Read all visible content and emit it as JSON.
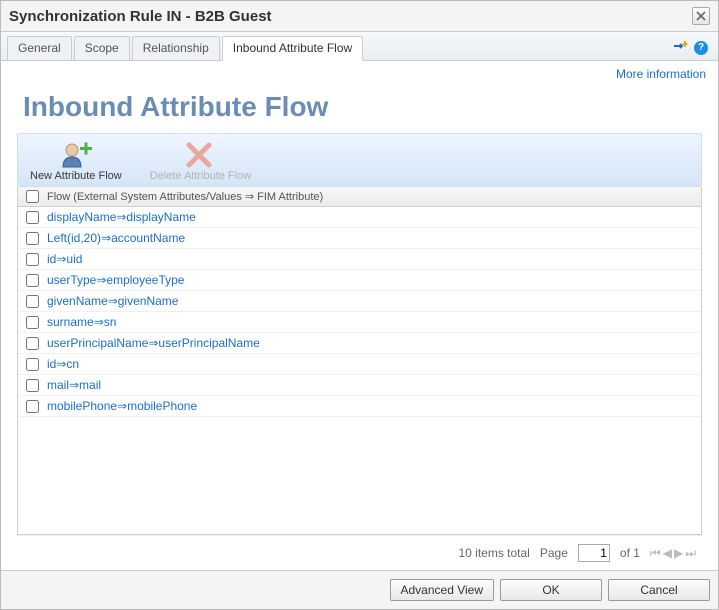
{
  "window": {
    "title": "Synchronization Rule IN - B2B Guest"
  },
  "tabs": {
    "general": "General",
    "scope": "Scope",
    "relationship": "Relationship",
    "inbound": "Inbound Attribute Flow"
  },
  "links": {
    "more_info": "More information"
  },
  "page": {
    "heading": "Inbound Attribute Flow"
  },
  "actions": {
    "new_flow": "New Attribute Flow",
    "delete_flow": "Delete Attribute Flow"
  },
  "table": {
    "header": "Flow (External System Attributes/Values ⇒ FIM Attribute)",
    "rows": [
      "displayName⇒displayName",
      "Left(id,20)⇒accountName",
      "id⇒uid",
      "userType⇒employeeType",
      "givenName⇒givenName",
      "surname⇒sn",
      "userPrincipalName⇒userPrincipalName",
      "id⇒cn",
      "mail⇒mail",
      "mobilePhone⇒mobilePhone"
    ]
  },
  "pager": {
    "items_total": "10 items total",
    "page_label": "Page",
    "page_value": "1",
    "of_label": "of 1"
  },
  "footer": {
    "advanced": "Advanced View",
    "ok": "OK",
    "cancel": "Cancel"
  }
}
